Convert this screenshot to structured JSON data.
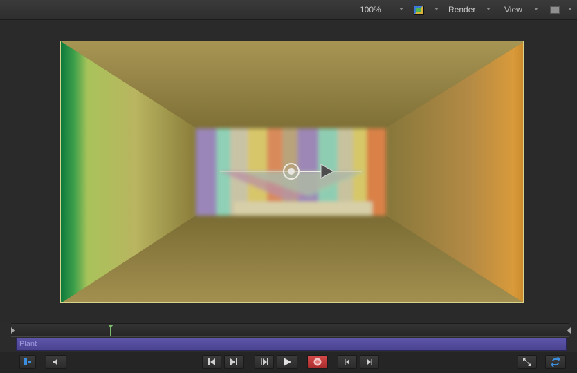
{
  "toolbar": {
    "zoom_label": "100%",
    "render_label": "Render",
    "view_label": "View"
  },
  "canvas": {
    "background_color": "#7c6e35",
    "border_color": "#d9d28a"
  },
  "timeline": {
    "track_label": "Plant",
    "track_color": "#5149a0",
    "playhead_color": "#7ab86a"
  },
  "transport": {
    "record_color": "#c43b3b",
    "loop_color": "#3c8fe0"
  },
  "icons": [
    "color-channels-icon",
    "layout-icon",
    "chevron-down-icon",
    "speaker-icon",
    "go-to-start-icon",
    "step-forward-icon",
    "play-icon",
    "record-icon",
    "fullscreen-icon",
    "loop-icon"
  ]
}
